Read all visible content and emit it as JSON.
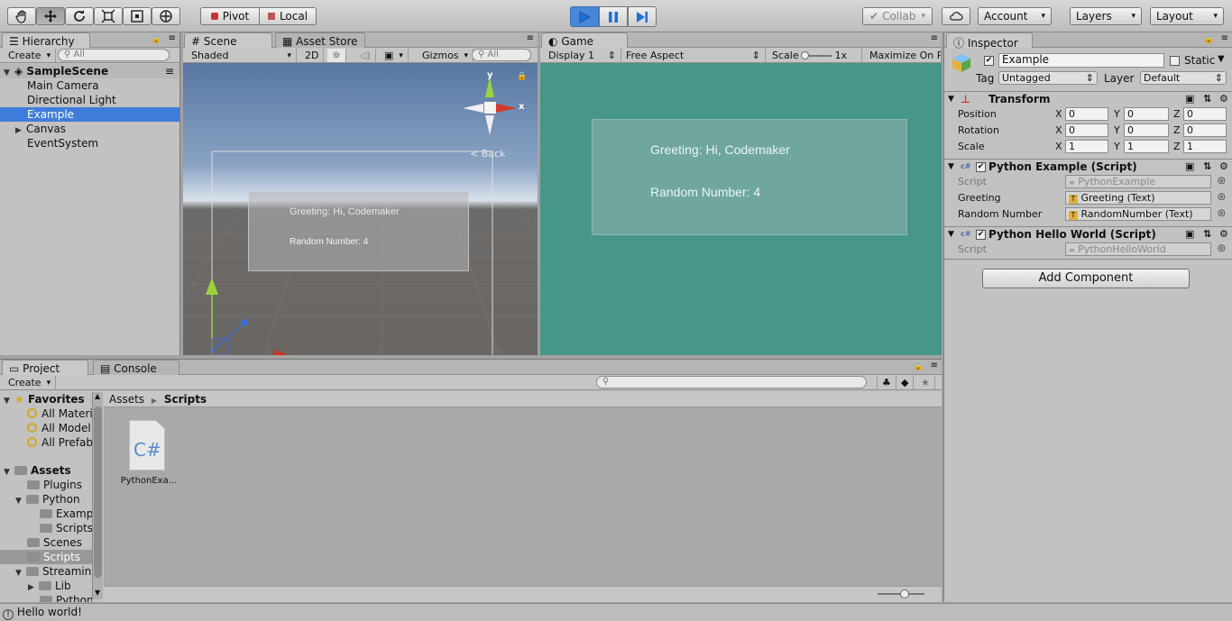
{
  "toolbar": {
    "pivot": "Pivot",
    "local": "Local",
    "collab": "Collab",
    "account": "Account",
    "layers": "Layers",
    "layout": "Layout"
  },
  "hierarchy": {
    "tab": "Hierarchy",
    "create": "Create",
    "search_placeholder": "All",
    "scene_name": "SampleScene",
    "items": [
      "Main Camera",
      "Directional Light",
      "Example",
      "Canvas",
      "EventSystem"
    ]
  },
  "scene": {
    "tab_scene": "Scene",
    "tab_store": "Asset Store",
    "shading": "Shaded",
    "mode2d": "2D",
    "gizmos": "Gizmos",
    "search_placeholder": "All",
    "gizmo_y": "y",
    "gizmo_x": "x",
    "back_label": "Back",
    "greeting": "Greeting: Hi, Codemaker",
    "random": "Random Number: 4"
  },
  "game": {
    "tab": "Game",
    "display": "Display 1",
    "aspect": "Free Aspect",
    "scale_label": "Scale",
    "scale_value": "1x",
    "maximize": "Maximize On Pl",
    "greeting": "Greeting: Hi, Codemaker",
    "random": "Random Number: 4"
  },
  "inspector": {
    "tab": "Inspector",
    "object_name": "Example",
    "static_label": "Static",
    "tag_label": "Tag",
    "tag_value": "Untagged",
    "layer_label": "Layer",
    "layer_value": "Default",
    "transform": {
      "title": "Transform",
      "position_label": "Position",
      "rotation_label": "Rotation",
      "scale_label": "Scale",
      "x": "X",
      "y": "Y",
      "z": "Z",
      "position": [
        "0",
        "0",
        "0"
      ],
      "rotation": [
        "0",
        "0",
        "0"
      ],
      "scale": [
        "1",
        "1",
        "1"
      ]
    },
    "python_example": {
      "title": "Python Example (Script)",
      "script_label": "Script",
      "script_value": "PythonExample",
      "greeting_label": "Greeting",
      "greeting_value": "Greeting (Text)",
      "random_label": "Random Number",
      "random_value": "RandomNumber (Text)"
    },
    "python_hello": {
      "title": "Python Hello World (Script)",
      "script_label": "Script",
      "script_value": "PythonHelloWorld"
    },
    "add_component": "Add Component"
  },
  "project": {
    "tab_project": "Project",
    "tab_console": "Console",
    "create": "Create",
    "favorites": "Favorites",
    "fav_items": [
      "All Materi",
      "All Model",
      "All Prefab"
    ],
    "assets": "Assets",
    "tree": [
      "Plugins",
      "Python",
      "Examp",
      "Scripts",
      "Scenes",
      "Scripts",
      "Streamin",
      "Lib",
      "Python"
    ],
    "breadcrumb_root": "Assets",
    "breadcrumb_current": "Scripts",
    "file_icon_text": "C#",
    "file_name": "PythonExa..."
  },
  "status": {
    "message": "Hello world!"
  },
  "colors": {
    "game_bg": "#469689",
    "selection": "#3e7ddb",
    "play_active": "#1f6fdc"
  }
}
